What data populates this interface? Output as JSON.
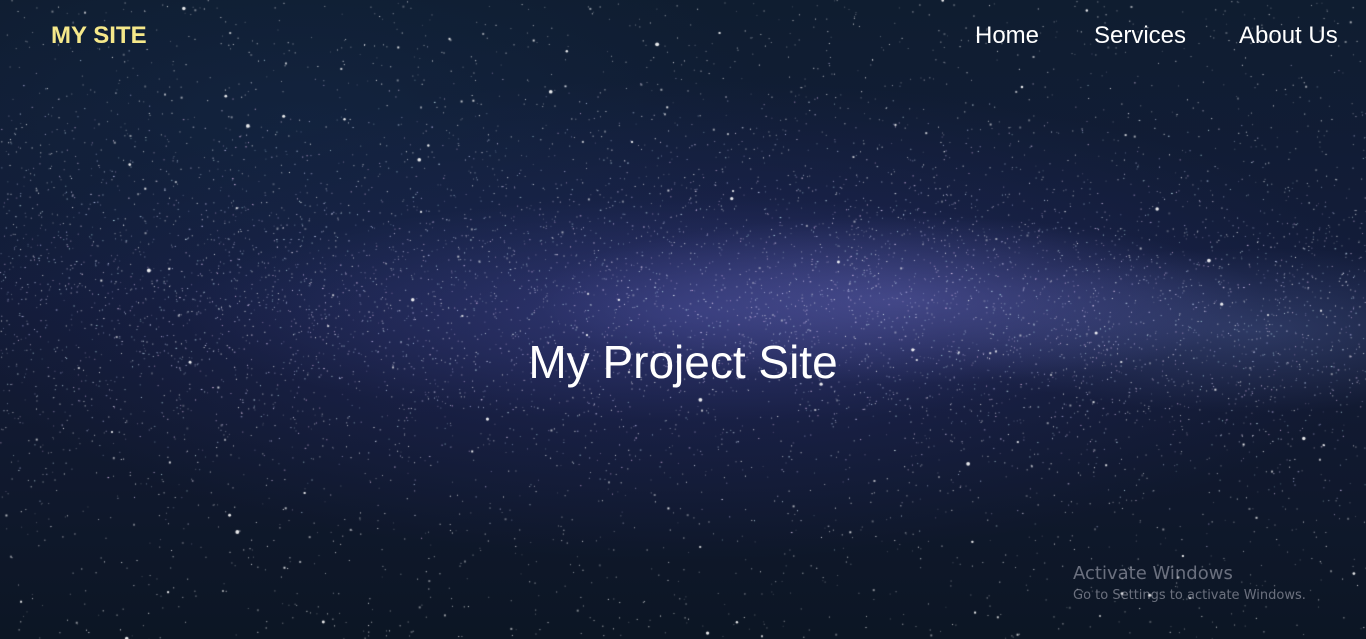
{
  "nav": {
    "logo": "MY SITE",
    "links": [
      "Home",
      "Services",
      "About Us"
    ]
  },
  "hero": {
    "title": "My Project Site"
  },
  "watermark": {
    "title": "Activate Windows",
    "subtitle": "Go to Settings to activate Windows."
  },
  "colors": {
    "logo": "#f5e88a",
    "nav_text": "#ffffff",
    "background": "#0d1526"
  }
}
